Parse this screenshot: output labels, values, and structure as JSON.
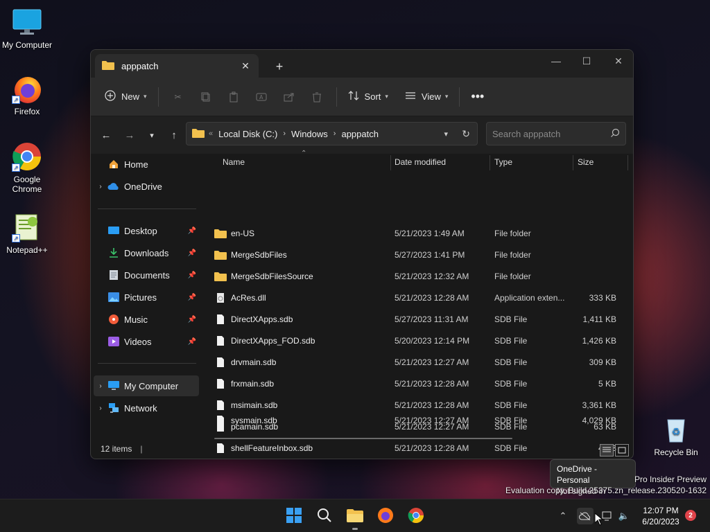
{
  "desktop": {
    "icons": [
      {
        "label": "My Computer",
        "icon": "monitor-icon"
      },
      {
        "label": "Firefox",
        "icon": "firefox-icon"
      },
      {
        "label": "Google Chrome",
        "icon": "chrome-icon"
      },
      {
        "label": "Notepad++",
        "icon": "notepad-plus-plus-icon"
      },
      {
        "label": "Recycle Bin",
        "icon": "recycle-bin-icon"
      }
    ]
  },
  "window": {
    "tab_title": "apppatch",
    "toolbar": {
      "new_label": "New",
      "sort_label": "Sort",
      "view_label": "View"
    },
    "address": {
      "crumbs": [
        "Local Disk (C:)",
        "Windows",
        "apppatch"
      ]
    },
    "search": {
      "placeholder": "Search apppatch"
    },
    "sidebar": {
      "items": [
        {
          "label": "Home",
          "icon": "home-icon"
        },
        {
          "label": "OneDrive",
          "icon": "onedrive-icon"
        },
        {
          "label": "Desktop",
          "icon": "desktop-icon",
          "pinned": true
        },
        {
          "label": "Downloads",
          "icon": "downloads-icon",
          "pinned": true
        },
        {
          "label": "Documents",
          "icon": "documents-icon",
          "pinned": true
        },
        {
          "label": "Pictures",
          "icon": "pictures-icon",
          "pinned": true
        },
        {
          "label": "Music",
          "icon": "music-icon",
          "pinned": true
        },
        {
          "label": "Videos",
          "icon": "videos-icon",
          "pinned": true
        },
        {
          "label": "My Computer",
          "icon": "computer-icon",
          "selected": true
        },
        {
          "label": "Network",
          "icon": "network-icon"
        }
      ]
    },
    "columns": {
      "name": "Name",
      "date": "Date modified",
      "type": "Type",
      "size": "Size"
    },
    "files": [
      {
        "name": "en-US",
        "date": "5/21/2023 1:49 AM",
        "type": "File folder",
        "size": "",
        "kind": "folder"
      },
      {
        "name": "MergeSdbFiles",
        "date": "5/27/2023 1:41 PM",
        "type": "File folder",
        "size": "",
        "kind": "folder"
      },
      {
        "name": "MergeSdbFilesSource",
        "date": "5/21/2023 12:32 AM",
        "type": "File folder",
        "size": "",
        "kind": "folder"
      },
      {
        "name": "AcRes.dll",
        "date": "5/21/2023 12:28 AM",
        "type": "Application exten...",
        "size": "333 KB",
        "kind": "dll"
      },
      {
        "name": "DirectXApps.sdb",
        "date": "5/27/2023 11:31 AM",
        "type": "SDB File",
        "size": "1,411 KB",
        "kind": "file"
      },
      {
        "name": "DirectXApps_FOD.sdb",
        "date": "5/20/2023 12:14 PM",
        "type": "SDB File",
        "size": "1,426 KB",
        "kind": "file"
      },
      {
        "name": "drvmain.sdb",
        "date": "5/21/2023 12:27 AM",
        "type": "SDB File",
        "size": "309 KB",
        "kind": "file"
      },
      {
        "name": "frxmain.sdb",
        "date": "5/21/2023 12:28 AM",
        "type": "SDB File",
        "size": "5 KB",
        "kind": "file"
      },
      {
        "name": "msimain.sdb",
        "date": "5/21/2023 12:28 AM",
        "type": "SDB File",
        "size": "3,361 KB",
        "kind": "file"
      },
      {
        "name": "pcamain.sdb",
        "date": "5/21/2023 12:27 AM",
        "type": "SDB File",
        "size": "63 KB",
        "kind": "file"
      },
      {
        "name": "shellFeatureInbox.sdb",
        "date": "5/21/2023 12:28 AM",
        "type": "SDB File",
        "size": "4 KB",
        "kind": "file"
      },
      {
        "name": "sysmain.sdb",
        "date": "5/21/2023 12:27 AM",
        "type": "SDB File",
        "size": "4,029 KB",
        "kind": "file"
      }
    ],
    "status": {
      "item_count": "12 items"
    }
  },
  "tooltip": {
    "line1": "OneDrive - Personal",
    "line2": "Not signed in"
  },
  "watermark": {
    "line1": "Pro Insider Preview",
    "line2": "Evaluation copy. Build 25375.zn_release.230520-1632"
  },
  "taskbar": {
    "clock_time": "12:07 PM",
    "clock_date": "6/20/2023",
    "notification_count": "2"
  },
  "colors": {
    "accent": "#0078d4",
    "folder": "#f2c14e",
    "window_bg": "#191919"
  }
}
